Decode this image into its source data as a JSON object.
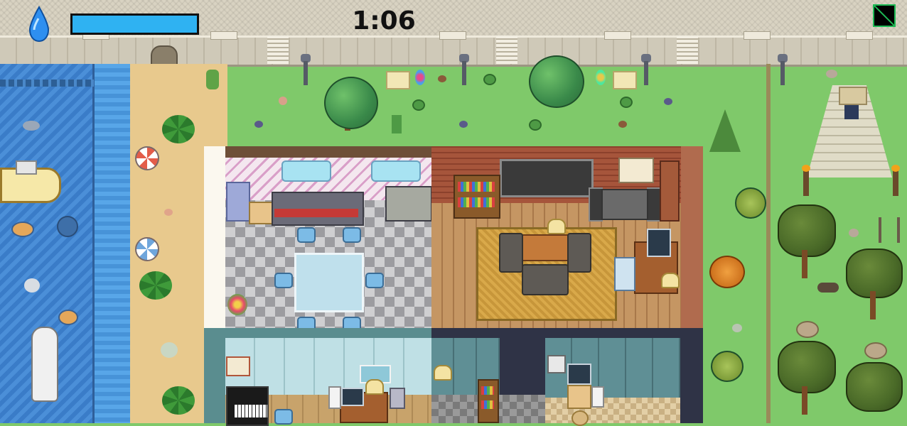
{
  "hud": {
    "timer": "1:06",
    "water_level": 1.0,
    "water_color": "#2fb2f2",
    "water_icon": "water-drop-icon",
    "minimap_icon": "minimap-toggle-icon"
  },
  "colors": {
    "grass": "#7fc96a",
    "sea": "#3a7cc8",
    "sand": "#e8c98d",
    "wall": "#d9d3c2"
  }
}
